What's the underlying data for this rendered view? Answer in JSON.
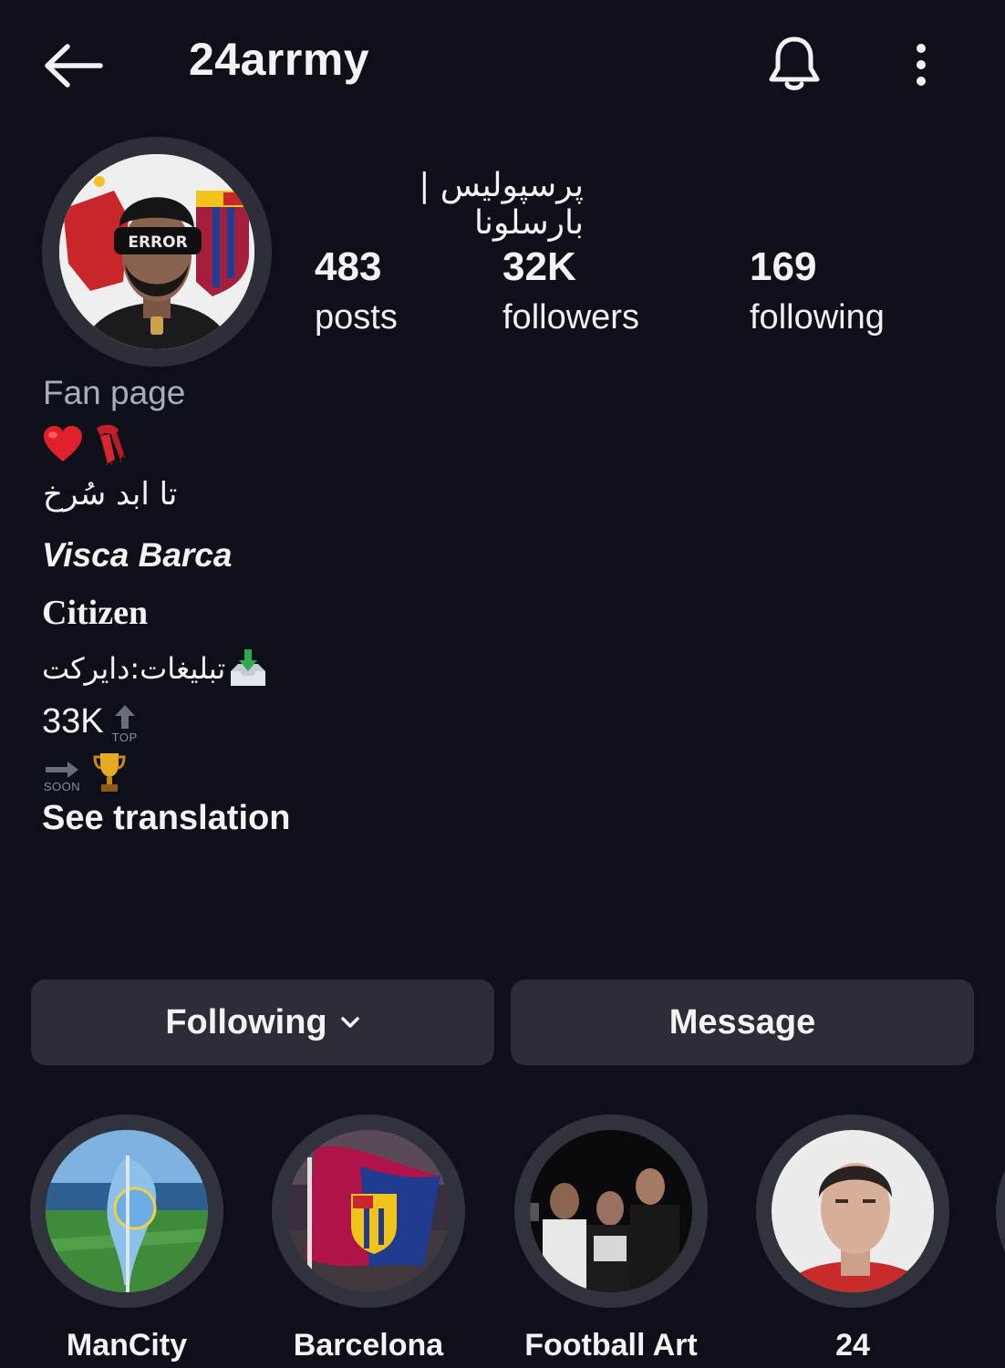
{
  "header": {
    "username": "24arrmy",
    "icons": {
      "back": "arrow-left-icon",
      "notifications": "bell-icon",
      "more": "more-vertical-icon"
    }
  },
  "profile": {
    "display_name": "پرسپولیس | بارسلونا",
    "avatar_text": "ERROR",
    "stats": [
      {
        "value": "483",
        "label": "posts"
      },
      {
        "value": "32K",
        "label": "followers"
      },
      {
        "value": "169",
        "label": "following"
      }
    ]
  },
  "bio": {
    "category": "Fan page",
    "emojis_line": [
      "red-heart-icon",
      "red-scarf-icon"
    ],
    "line1": "تا ابد سُرخ",
    "line2": "Visca Barca",
    "line3": "Citizen",
    "line4": "تبلیغات:دایرکت",
    "line4_icon": "inbox-tray-icon",
    "line5": "33K",
    "line5_icon": "top-arrow-icon",
    "line5_tag": "TOP",
    "line6_icons": [
      "soon-arrow-icon",
      "trophy-icon"
    ],
    "line6_tag": "SOON",
    "see_translation": "See translation"
  },
  "actions": {
    "following_label": "Following",
    "message_label": "Message"
  },
  "highlights": [
    {
      "label": "ManCity"
    },
    {
      "label": "Barcelona"
    },
    {
      "label": "Football Art"
    },
    {
      "label": "24"
    }
  ],
  "colors": {
    "background": "#0d1019",
    "button": "#2a2d35",
    "muted_text": "#a9adb6"
  }
}
